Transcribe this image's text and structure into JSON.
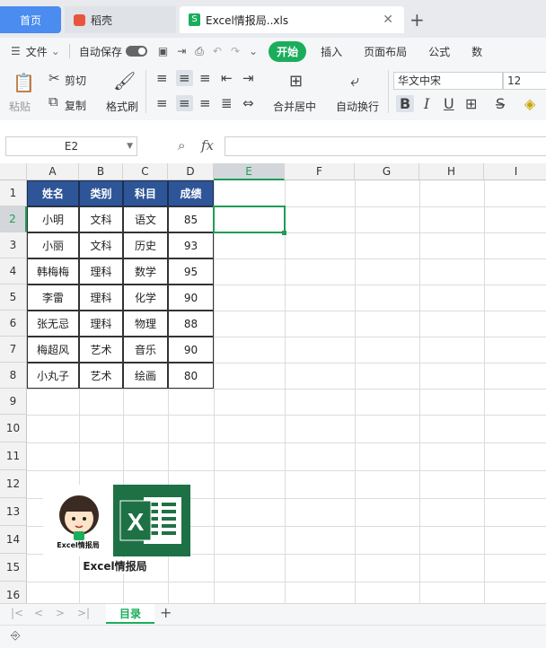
{
  "tabs": {
    "home": "首页",
    "doc": "稻壳",
    "file": "Excel情报局..xls",
    "add": "+",
    "close": "✕"
  },
  "menu": {
    "file": "文件",
    "autosave": "自动保存",
    "items": [
      "开始",
      "插入",
      "页面布局",
      "公式",
      "数"
    ]
  },
  "ribbon": {
    "paste": "粘贴",
    "cut": "剪切",
    "copy": "复制",
    "format_painter": "格式刷",
    "merge": "合并居中",
    "wrap": "自动换行",
    "font_name": "华文中宋",
    "font_size": "12",
    "bold": "B",
    "italic": "I",
    "underline": "U"
  },
  "formula_bar": {
    "name_box": "E2",
    "fx": "fx",
    "value": ""
  },
  "grid": {
    "columns": [
      "A",
      "B",
      "C",
      "D",
      "E",
      "F",
      "G",
      "H",
      "I"
    ],
    "rows": [
      "1",
      "2",
      "3",
      "4",
      "5",
      "6",
      "7",
      "8",
      "9",
      "10",
      "11",
      "12",
      "13",
      "14",
      "15",
      "16"
    ],
    "headers": [
      "姓名",
      "类别",
      "科目",
      "成绩"
    ],
    "data": [
      [
        "小明",
        "文科",
        "语文",
        "85"
      ],
      [
        "小丽",
        "文科",
        "历史",
        "93"
      ],
      [
        "韩梅梅",
        "理科",
        "数学",
        "95"
      ],
      [
        "李雷",
        "理科",
        "化学",
        "90"
      ],
      [
        "张无忌",
        "理科",
        "物理",
        "88"
      ],
      [
        "梅超风",
        "艺术",
        "音乐",
        "90"
      ],
      [
        "小丸子",
        "艺术",
        "绘画",
        "80"
      ]
    ],
    "selected": "E2"
  },
  "logo": {
    "badge_text": "Excel情报局",
    "caption": "Excel情报局"
  },
  "sheets": {
    "active": "目录",
    "add": "+"
  },
  "colors": {
    "accent": "#1aad5c",
    "header_fill": "#2e5597",
    "tab_blue": "#4a8cf0",
    "excel_green": "#1e7145"
  }
}
